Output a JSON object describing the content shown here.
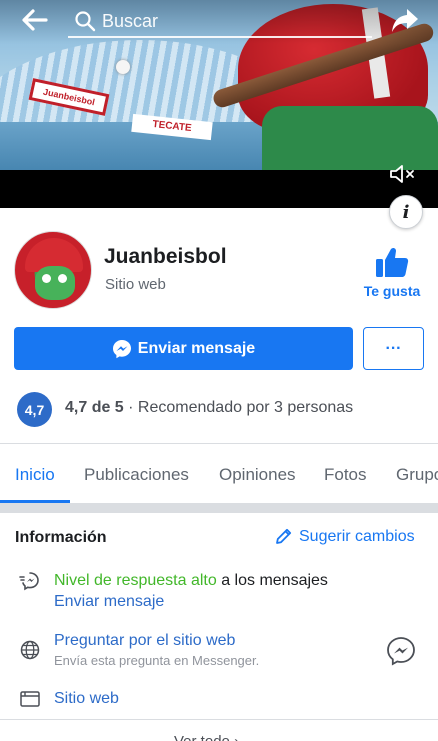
{
  "topbar": {
    "search_placeholder": "Buscar"
  },
  "profile": {
    "name": "Juanbeisbol",
    "category": "Sitio web",
    "like_label": "Te gusta"
  },
  "actions": {
    "message_label": "Enviar mensaje",
    "more_label": "···"
  },
  "rating": {
    "badge": "4,7",
    "score_text": "4,7 de 5",
    "recommend_text": " · Recomendado por 3 personas"
  },
  "tabs": [
    {
      "label": "Inicio"
    },
    {
      "label": "Publicaciones"
    },
    {
      "label": "Opiniones"
    },
    {
      "label": "Fotos"
    },
    {
      "label": "Grupos"
    }
  ],
  "info": {
    "title": "Información",
    "suggest_label": "Sugerir cambios",
    "response_highlight": "Nivel de respuesta alto",
    "response_rest": " a los mensajes",
    "send_message_link": "Enviar mensaje",
    "ask_title": "Preguntar por el sitio web",
    "ask_sub": "Envía esta pregunta en Messenger.",
    "website_label": "Sitio web",
    "see_all": "Ver todo"
  },
  "cover": {
    "banner_left": "Juanbeisbol",
    "banner_right": "TECATE"
  },
  "colors": {
    "accent": "#1877f2",
    "link": "#2d6bc8",
    "highlight_green": "#42b72a"
  }
}
